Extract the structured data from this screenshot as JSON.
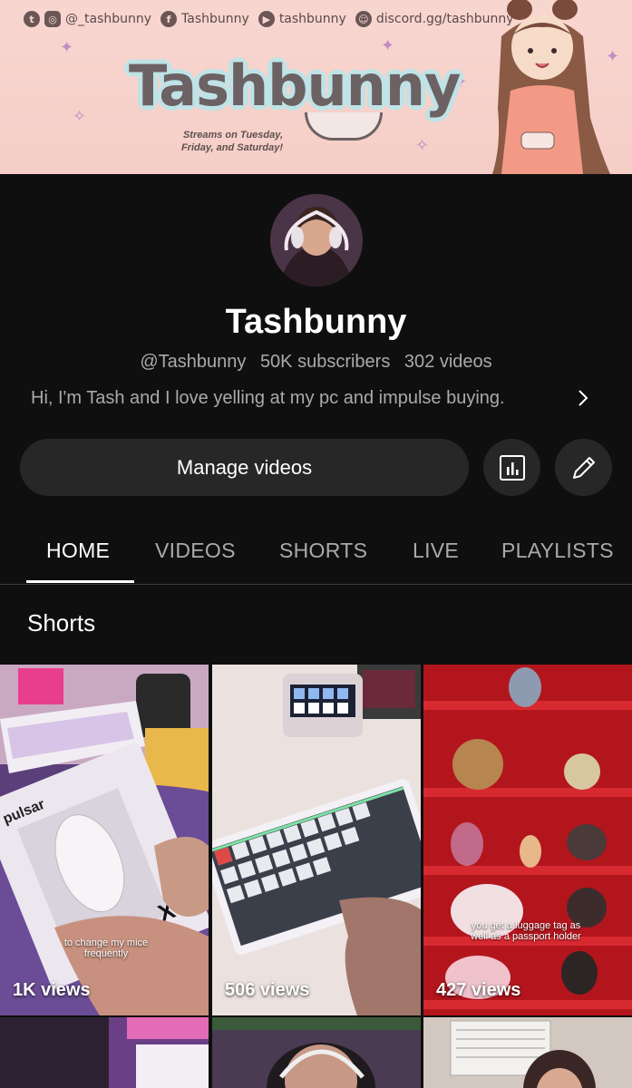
{
  "banner": {
    "social": [
      {
        "icon": "twitter-icon",
        "glyph": "t"
      },
      {
        "icon": "instagram-icon",
        "glyph": "◎",
        "label": "@_tashbunny"
      },
      {
        "icon": "facebook-icon",
        "glyph": "f",
        "label": "Tashbunny"
      },
      {
        "icon": "youtube-icon",
        "glyph": "▶",
        "label": "tashbunny"
      },
      {
        "icon": "discord-icon",
        "glyph": "☺",
        "label": "discord.gg/tashbunny"
      }
    ],
    "logo": "Tashbunny",
    "stream_note": "Streams on Tuesday, Friday, and Saturday!"
  },
  "channel": {
    "name": "Tashbunny",
    "handle": "@Tashbunny",
    "subscribers": "50K subscribers",
    "videos": "302 videos",
    "description": "Hi, I'm Tash and I love yelling at my pc and impulse buying."
  },
  "actions": {
    "manage_label": "Manage videos"
  },
  "tabs": [
    "HOME",
    "VIDEOS",
    "SHORTS",
    "LIVE",
    "PLAYLISTS"
  ],
  "section_title": "Shorts",
  "shorts": [
    {
      "views": "1K views",
      "caption": "to change my mice frequently"
    },
    {
      "views": "506 views"
    },
    {
      "views": "427 views",
      "caption": "you get a luggage tag as well as a passport holder"
    }
  ],
  "colors": {
    "background": "#0f0f0f",
    "button": "#272727",
    "muted_text": "#aaaaaa"
  }
}
